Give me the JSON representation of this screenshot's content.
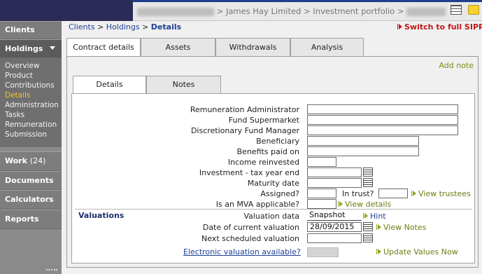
{
  "topbar": {
    "path_text": "> James Hay Limited > Investment portfolio >"
  },
  "sidebar": {
    "clients": "Clients",
    "holdings": "Holdings",
    "subnav": [
      "Overview",
      "Product",
      "Contributions",
      "Details",
      "Administration",
      "Tasks",
      "Remuneration",
      "Submission"
    ],
    "work": "Work",
    "work_count": "(24)",
    "documents": "Documents",
    "calculators": "Calculators",
    "reports": "Reports"
  },
  "breadcrumb": {
    "clients": "Clients",
    "sep1": " > ",
    "holdings": "Holdings",
    "sep2": " > ",
    "current": "Details"
  },
  "switch_link": "Switch to full SIPP",
  "tabs": [
    "Contract details",
    "Assets",
    "Withdrawals",
    "Analysis"
  ],
  "add_note": "Add note",
  "inner_tabs": [
    "Details",
    "Notes"
  ],
  "form": {
    "remuneration_administrator": "Remuneration Administrator",
    "fund_supermarket": "Fund Supermarket",
    "discretionary_fund_manager": "Discretionary Fund Manager",
    "beneficiary": "Beneficiary",
    "benefits_paid_on": "Benefits paid on",
    "income_reinvested": "Income reinvested",
    "investment_tax_year_end": "Investment - tax year end",
    "maturity_date": "Maturity date",
    "assigned": "Assigned?",
    "in_trust": "In trust?",
    "view_trustees": "View trustees",
    "is_mva_applicable": "Is an MVA applicable?",
    "view_details": "View details"
  },
  "valuations": {
    "title": "Valuations",
    "valuation_data_label": "Valuation data",
    "valuation_data_value": "Snapshot",
    "hint": "Hint",
    "date_current_label": "Date of current valuation",
    "date_current_value": "28/09/2015",
    "view_notes": "View Notes",
    "next_scheduled_label": "Next scheduled valuation",
    "electronic_link": "Electronic valuation available?",
    "update_values": "Update Values Now"
  }
}
